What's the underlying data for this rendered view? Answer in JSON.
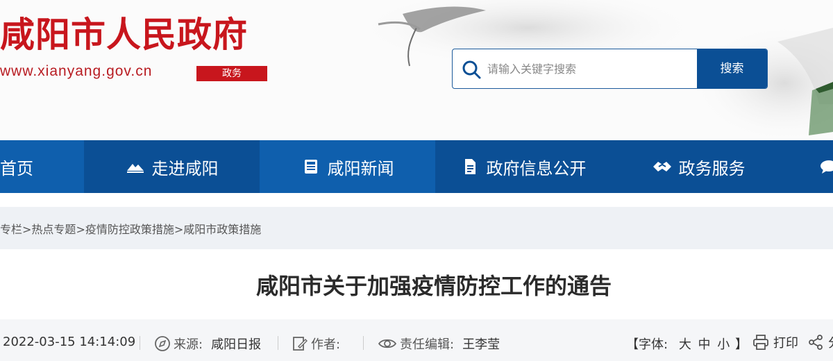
{
  "header": {
    "site_title": "咸阳市人民政府",
    "site_url": "www.xianyang.gov.cn",
    "site_tag": "政务"
  },
  "search": {
    "placeholder": "请输入关键字搜索",
    "button_label": "搜索",
    "icon": "search-icon"
  },
  "nav": {
    "items": [
      {
        "label": "首页",
        "icon": ""
      },
      {
        "label": "走进咸阳",
        "icon": "mountain-icon"
      },
      {
        "label": "咸阳新闻",
        "icon": "news-icon"
      },
      {
        "label": "政府信息公开",
        "icon": "document-icon"
      },
      {
        "label": "政务服务",
        "icon": "handshake-icon"
      }
    ],
    "colors": {
      "primary": "#0f5fad",
      "dark": "#0b4f95"
    }
  },
  "breadcrumb": {
    "items": [
      "专栏",
      "热点专题",
      "疫情防控政策措施",
      "咸阳市政策措施"
    ],
    "separator": ">"
  },
  "article": {
    "title": "咸阳市关于加强疫情防控工作的通告",
    "date": "2022-03-15 14:14:09",
    "source_label": "来源:",
    "source_value": "咸阳日报",
    "author_label": "作者:",
    "author_value": "",
    "editor_label": "责任编辑:",
    "editor_value": "王李莹"
  },
  "tools": {
    "font_prefix": "【字体:",
    "font_large": "大",
    "font_medium": "中",
    "font_small": "小",
    "font_suffix": "】",
    "print_label": "打印",
    "share_label": "分"
  },
  "colors": {
    "brand_red": "#c8161d",
    "brand_blue": "#0b4f95"
  }
}
